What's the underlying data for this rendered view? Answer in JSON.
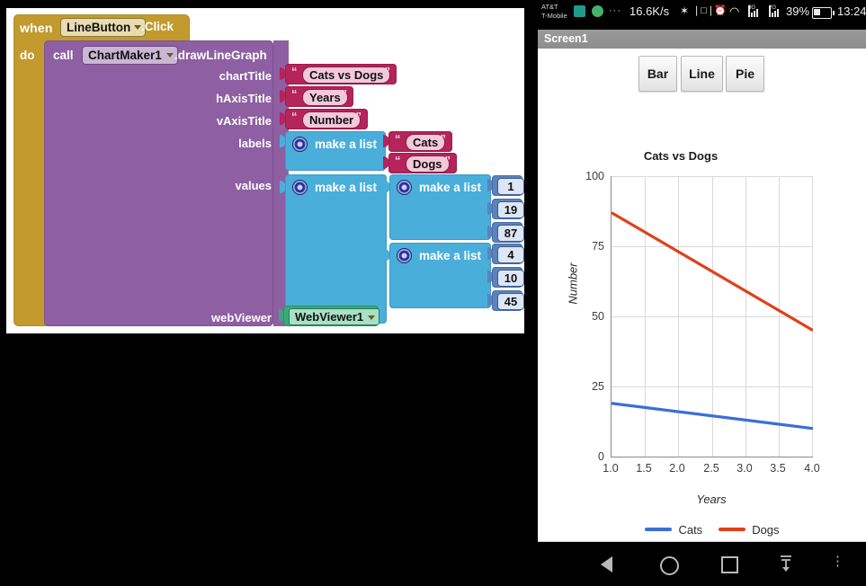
{
  "blocks": {
    "event": {
      "when_label": "when",
      "component": "LineButton",
      "event_name": ".Click",
      "do_label": "do"
    },
    "call": {
      "call_label": "call",
      "component": "ChartMaker1",
      "method": ".drawLineGraph"
    },
    "args": [
      {
        "name": "chartTitle",
        "kind": "text",
        "value": "Cats vs Dogs"
      },
      {
        "name": "hAxisTitle",
        "kind": "text",
        "value": "Years"
      },
      {
        "name": "vAxisTitle",
        "kind": "text",
        "value": "Number"
      },
      {
        "name": "labels",
        "kind": "list",
        "value": "make a list"
      },
      {
        "name": "values",
        "kind": "list",
        "value": "make a list"
      },
      {
        "name": "webViewer",
        "kind": "component",
        "value": "WebViewer1"
      }
    ],
    "make_a_list_label": "make a list",
    "labels_items": [
      "Cats",
      "Dogs"
    ],
    "values_list_1": [
      "1",
      "19",
      "87"
    ],
    "values_list_2": [
      "4",
      "10",
      "45"
    ],
    "quote_glyph": "“",
    "quote_glyph_right": "”",
    "colors": {
      "event_block": "#c39a2e",
      "call_block": "#8e5fa2",
      "text_block": "#b5245b",
      "list_block": "#4aaedb",
      "number_block": "#5b83bd",
      "component_block": "#3aa87a"
    }
  },
  "phone": {
    "statusbar": {
      "carrier_line1": "AT&T",
      "carrier_line2": "T-Mobile",
      "overflow_dots": "···",
      "network_speed": "16.6K/s",
      "bluetooth": "✶",
      "vibrate": "❘□❘",
      "alarm": "⏰",
      "wifi": "◠",
      "sim1_label": "3G",
      "sim2_label": "2G",
      "battery_percent": "39%",
      "clock": "13:24"
    },
    "titlebar": {
      "title": "Screen1"
    },
    "buttons": [
      {
        "label": "Bar"
      },
      {
        "label": "Line"
      },
      {
        "label": "Pie"
      }
    ],
    "navbar": {
      "back": "back-icon",
      "home": "home-icon",
      "recents": "recents-icon",
      "download": "↓",
      "menu": "⋮"
    }
  },
  "chart_data": {
    "type": "line",
    "title": "Cats vs Dogs",
    "xlabel": "Years",
    "ylabel": "Number",
    "x": [
      1.0,
      2.0,
      3.0,
      4.0
    ],
    "xticklabels": [
      "1.0",
      "1.5",
      "2.0",
      "2.5",
      "3.0",
      "3.5",
      "4.0"
    ],
    "xtickvalues": [
      1.0,
      1.5,
      2.0,
      2.5,
      3.0,
      3.5,
      4.0
    ],
    "yticklabels": [
      "0",
      "25",
      "50",
      "75",
      "100"
    ],
    "ytickvalues": [
      0,
      25,
      50,
      75,
      100
    ],
    "xlim": [
      1.0,
      4.0
    ],
    "ylim": [
      0,
      100
    ],
    "grid": true,
    "legend_position": "bottom",
    "series": [
      {
        "name": "Cats",
        "color": "#3a6fd8",
        "values": [
          19,
          16,
          13,
          10
        ]
      },
      {
        "name": "Dogs",
        "color": "#e0401c",
        "values": [
          87,
          73,
          59,
          45
        ]
      }
    ]
  }
}
